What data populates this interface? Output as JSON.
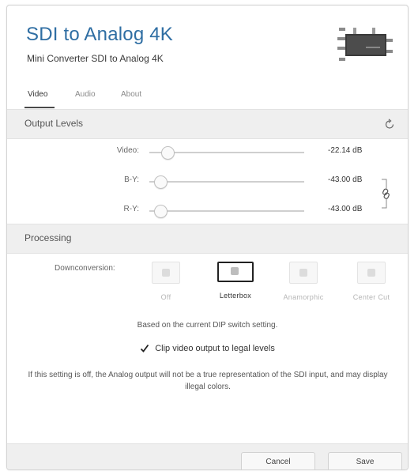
{
  "header": {
    "title": "SDI to Analog 4K",
    "subtitle": "Mini Converter SDI to Analog 4K"
  },
  "tabs": [
    {
      "label": "Video",
      "active": true
    },
    {
      "label": "Audio",
      "active": false
    },
    {
      "label": "About",
      "active": false
    }
  ],
  "output_levels": {
    "title": "Output Levels",
    "reset_icon": "reset-icon",
    "sliders": [
      {
        "label": "Video:",
        "value": "-22.14 dB",
        "level": 0.05
      },
      {
        "label": "B-Y:",
        "value": "-43.00 dB",
        "level": 0.0
      },
      {
        "label": "R-Y:",
        "value": "-43.00 dB",
        "level": 0.0
      }
    ],
    "link_icon": "chain-link-icon"
  },
  "processing": {
    "title": "Processing",
    "downconversion_label": "Downconversion:",
    "options": [
      {
        "label": "Off",
        "selected": false
      },
      {
        "label": "Letterbox",
        "selected": true
      },
      {
        "label": "Anamorphic",
        "selected": false
      },
      {
        "label": "Center Cut",
        "selected": false
      }
    ],
    "dip_note": "Based on the current DIP switch setting.",
    "clip_label": "Clip video output to legal levels",
    "clip_checked": true,
    "warning": "If this setting is off, the Analog output will not be a true representation of the SDI input, and may display illegal colors."
  },
  "footer": {
    "cancel_label": "Cancel",
    "save_label": "Save"
  },
  "colors": {
    "title_blue": "#2f6ea3",
    "section_bg": "#efefef"
  }
}
